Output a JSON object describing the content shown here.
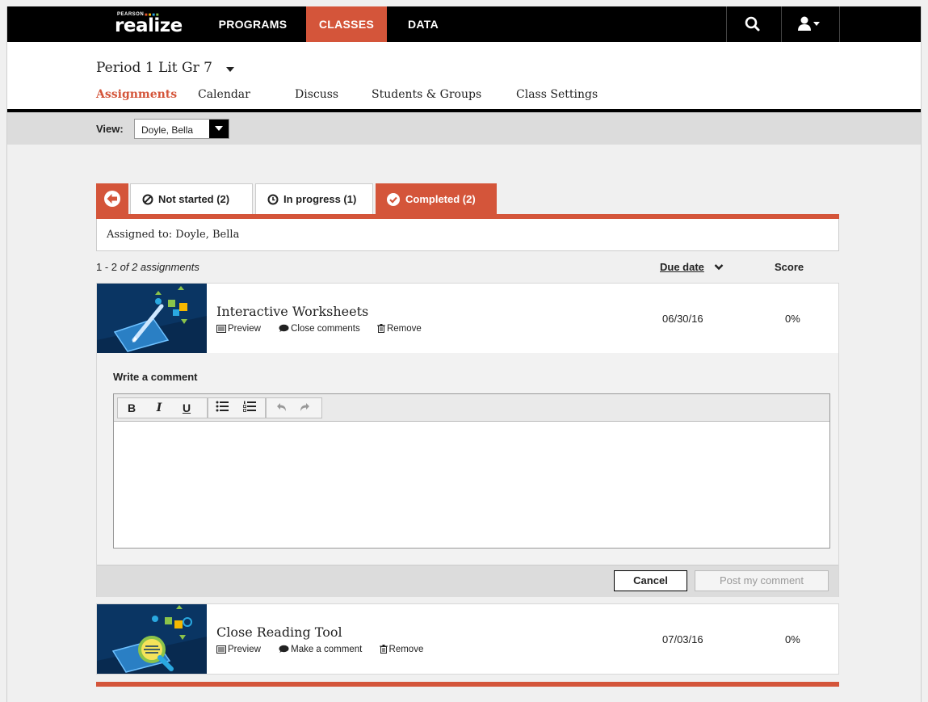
{
  "brand": {
    "top": "PEARSON",
    "word": "realize",
    "accent": "#d4553a"
  },
  "nav": {
    "programs": "PROGRAMS",
    "classes": "CLASSES",
    "data": "DATA"
  },
  "class_title": "Period 1 Lit Gr 7",
  "tabs": {
    "assignments": "Assignments",
    "calendar": "Calendar",
    "discuss": "Discuss",
    "students": "Students & Groups",
    "settings": "Class Settings"
  },
  "view": {
    "label": "View:",
    "selected": "Doyle, Bella"
  },
  "status_tabs": {
    "not_started": "Not started (2)",
    "in_progress": "In progress (1)",
    "completed": "Completed (2)"
  },
  "assigned_to": "Assigned to: Doyle, Bella",
  "count": {
    "range": "1 - 2",
    "rest": " of 2 assignments"
  },
  "columns": {
    "due": "Due date",
    "score": "Score"
  },
  "assignments": [
    {
      "title": "Interactive Worksheets",
      "preview": "Preview",
      "comment": "Close comments",
      "remove": "Remove",
      "due": "06/30/16",
      "score": "0%"
    },
    {
      "title": "Close Reading Tool",
      "preview": "Preview",
      "comment": "Make a comment",
      "remove": "Remove",
      "due": "07/03/16",
      "score": "0%"
    }
  ],
  "comment_box": {
    "label": "Write a comment",
    "cancel": "Cancel",
    "post": "Post my comment"
  },
  "toolbar": {
    "bold": "B",
    "italic": "I",
    "underline": "U"
  }
}
